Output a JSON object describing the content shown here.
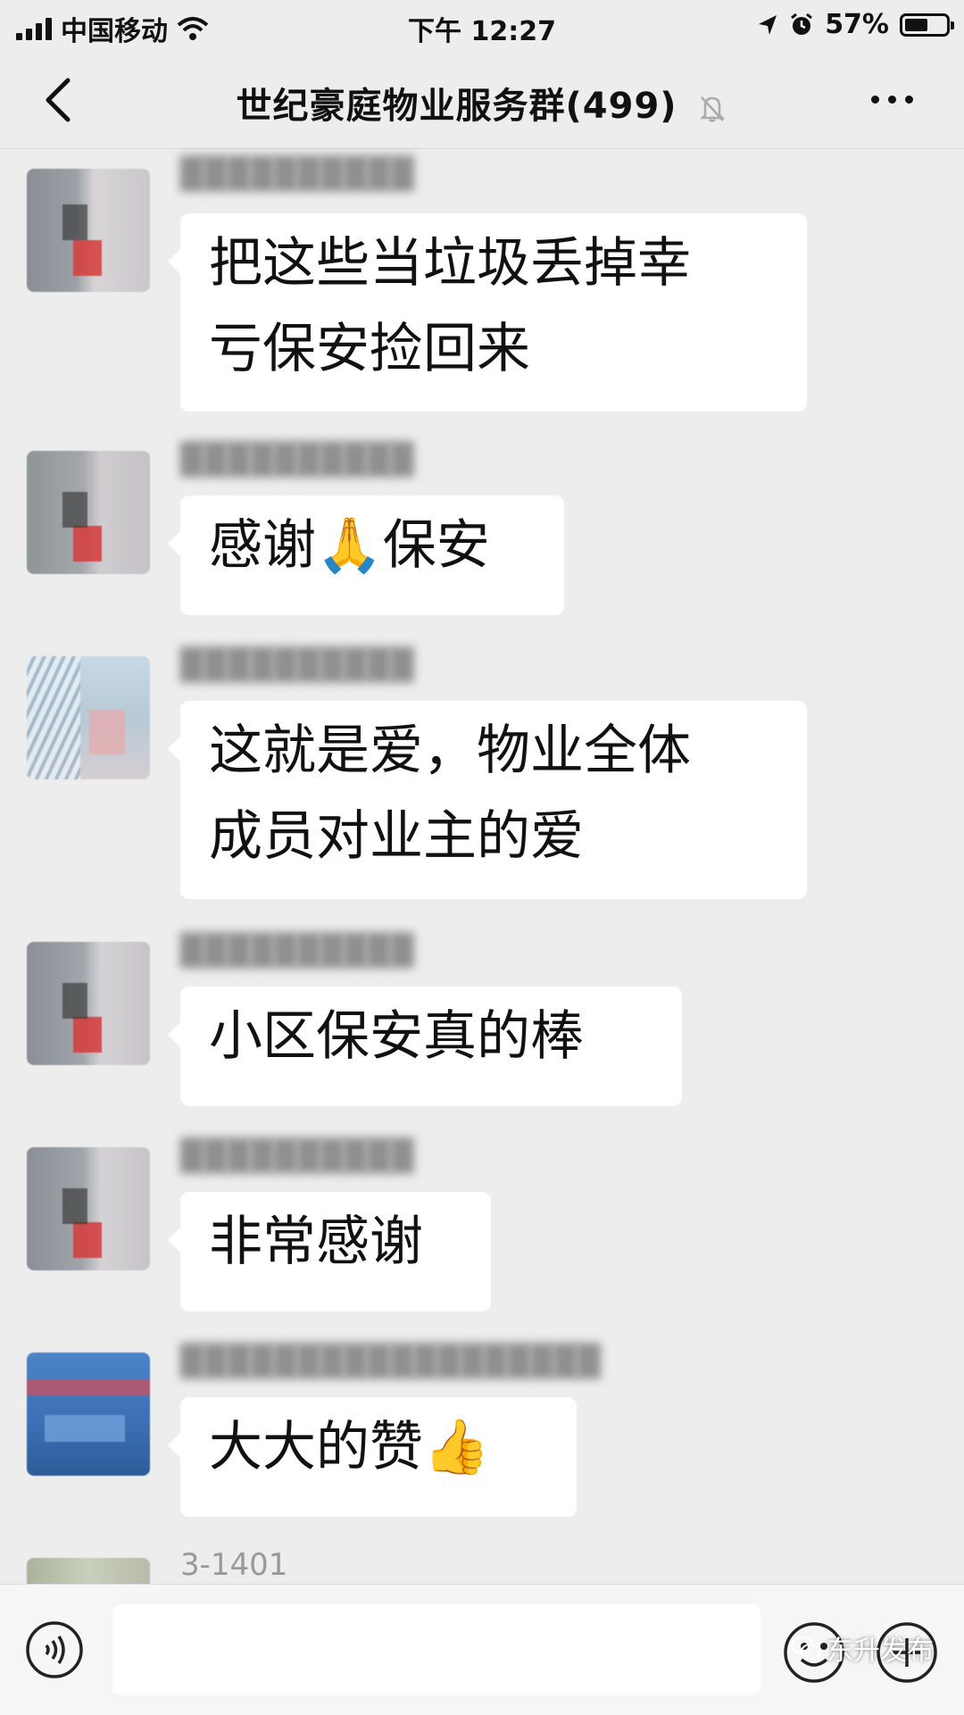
{
  "status_bar": {
    "carrier": "中国移动",
    "time": "下午 12:27",
    "battery": "57%",
    "battery_level": 0.57
  },
  "nav": {
    "title": "世纪豪庭物业服务群(499)",
    "icons": [
      "back-chevron-icon",
      "mute-bell-icon",
      "more-dots-icon"
    ]
  },
  "messages": [
    {
      "sender": "",
      "text_lines": [
        "把这些当垃圾丢掉幸",
        "亏保安捡回来"
      ]
    },
    {
      "sender": "",
      "text_lines": [
        "感谢🙏保安"
      ]
    },
    {
      "sender": "",
      "text_lines": [
        "这就是爱，物业全体",
        "成员对业主的爱"
      ]
    },
    {
      "sender": "",
      "text_lines": [
        "小区保安真的棒"
      ]
    },
    {
      "sender": "",
      "text_lines": [
        "非常感谢"
      ]
    },
    {
      "sender": "",
      "text_lines": [
        "大大的赞👍"
      ]
    },
    {
      "sender": "3-1401",
      "text_lines": []
    }
  ],
  "input_bar": {
    "placeholder": "",
    "icons": [
      "voice-icon",
      "emoji-icon",
      "plus-icon"
    ]
  },
  "watermark": "东升发布"
}
